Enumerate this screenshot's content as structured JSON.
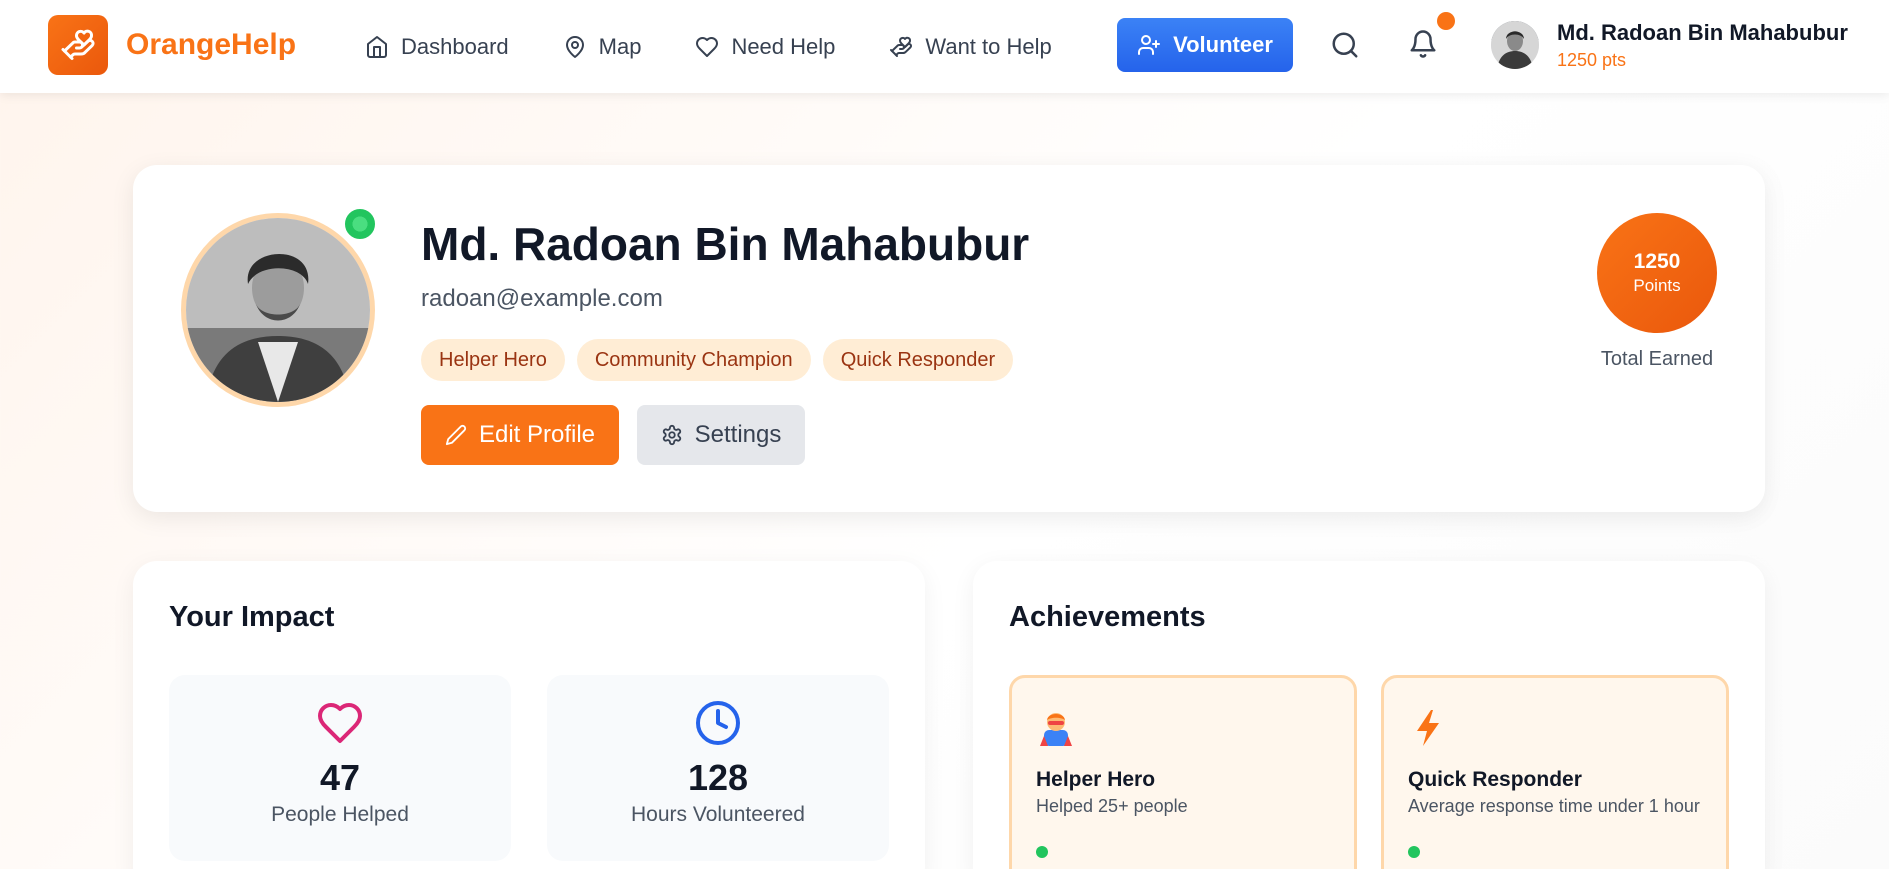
{
  "brand": {
    "name": "OrangeHelp"
  },
  "nav": {
    "items": [
      {
        "label": "Dashboard",
        "icon": "home-icon"
      },
      {
        "label": "Map",
        "icon": "map-pin-icon"
      },
      {
        "label": "Need Help",
        "icon": "heart-icon"
      },
      {
        "label": "Want to Help",
        "icon": "helping-hand-icon"
      }
    ],
    "volunteer_label": "Volunteer"
  },
  "user": {
    "name": "Md. Radoan Bin Mahabubur",
    "points_short": "1250 pts",
    "email": "radoan@example.com",
    "badges": [
      "Helper Hero",
      "Community Champion",
      "Quick Responder"
    ],
    "edit_label": "Edit Profile",
    "settings_label": "Settings",
    "points": "1250",
    "points_label": "Points",
    "total_earned_label": "Total Earned"
  },
  "impact": {
    "title": "Your Impact",
    "stats": [
      {
        "value": "47",
        "label": "People Helped",
        "icon": "heart-icon"
      },
      {
        "value": "128",
        "label": "Hours Volunteered",
        "icon": "clock-icon"
      }
    ]
  },
  "achievements": {
    "title": "Achievements",
    "items": [
      {
        "title": "Helper Hero",
        "desc": "Helped 25+ people",
        "icon": "superhero-icon"
      },
      {
        "title": "Quick Responder",
        "desc": "Average response time under 1 hour",
        "icon": "lightning-icon"
      }
    ]
  },
  "colors": {
    "brand": "#f97316",
    "volunteer": "#3b82f6",
    "online": "#22c55e",
    "badge_bg": "#ffedd5",
    "badge_text": "#9a3412"
  }
}
